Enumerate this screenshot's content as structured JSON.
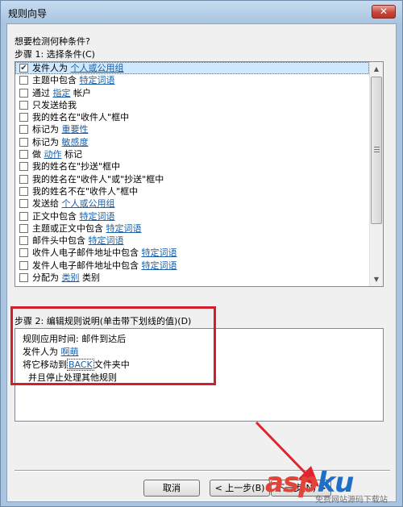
{
  "window": {
    "title": "规则向导",
    "close_glyph": "✕"
  },
  "question": "想要检测何种条件?",
  "step1_label": "步骤 1: 选择条件(C)",
  "conditions": [
    {
      "checked": true,
      "prefix": "发件人为 ",
      "link": "个人或公用组",
      "suffix": ""
    },
    {
      "checked": false,
      "prefix": "主题中包含 ",
      "link": "特定词语",
      "suffix": ""
    },
    {
      "checked": false,
      "prefix": "通过 ",
      "link": "指定",
      "suffix": " 帐户"
    },
    {
      "checked": false,
      "prefix": "只发送给我",
      "link": "",
      "suffix": ""
    },
    {
      "checked": false,
      "prefix": "我的姓名在\"收件人\"框中",
      "link": "",
      "suffix": ""
    },
    {
      "checked": false,
      "prefix": "标记为 ",
      "link": "重要性",
      "suffix": ""
    },
    {
      "checked": false,
      "prefix": "标记为 ",
      "link": "敏感度",
      "suffix": ""
    },
    {
      "checked": false,
      "prefix": "做 ",
      "link": "动作",
      "suffix": " 标记"
    },
    {
      "checked": false,
      "prefix": "我的姓名在\"抄送\"框中",
      "link": "",
      "suffix": ""
    },
    {
      "checked": false,
      "prefix": "我的姓名在\"收件人\"或\"抄送\"框中",
      "link": "",
      "suffix": ""
    },
    {
      "checked": false,
      "prefix": "我的姓名不在\"收件人\"框中",
      "link": "",
      "suffix": ""
    },
    {
      "checked": false,
      "prefix": "发送给 ",
      "link": "个人或公用组",
      "suffix": ""
    },
    {
      "checked": false,
      "prefix": "正文中包含 ",
      "link": "特定词语",
      "suffix": ""
    },
    {
      "checked": false,
      "prefix": "主题或正文中包含 ",
      "link": "特定词语",
      "suffix": ""
    },
    {
      "checked": false,
      "prefix": "邮件头中包含 ",
      "link": "特定词语",
      "suffix": ""
    },
    {
      "checked": false,
      "prefix": "收件人电子邮件地址中包含 ",
      "link": "特定词语",
      "suffix": ""
    },
    {
      "checked": false,
      "prefix": "发件人电子邮件地址中包含 ",
      "link": "特定词语",
      "suffix": ""
    },
    {
      "checked": false,
      "prefix": "分配为 ",
      "link": "类别",
      "suffix": " 类别"
    }
  ],
  "step2_label": "步骤 2: 编辑规则说明(单击带下划线的值)(D)",
  "description": {
    "line1": "规则应用时间: 邮件到达后",
    "line2_prefix": "发件人为 ",
    "line2_link": "啊萌",
    "line3_prefix": "将它移动到",
    "line3_folder": "BACK",
    "line3_suffix": "文件夹中",
    "line4": "并且停止处理其他规则"
  },
  "buttons": {
    "cancel": "取消",
    "back": "< 上一步(B)",
    "next": "下一步(N) >"
  },
  "watermark": {
    "a": "asp",
    "k": "ku",
    "sub": "免费网站源码下载站"
  }
}
